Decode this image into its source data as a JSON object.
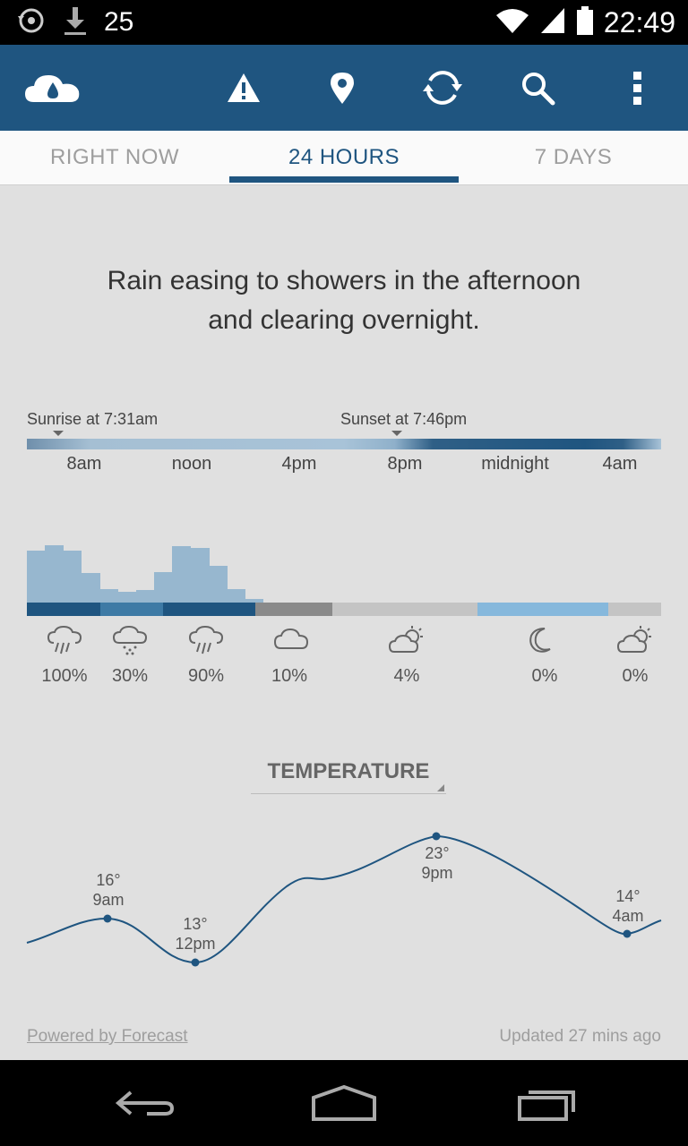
{
  "status_bar": {
    "notification_count": "25",
    "time": "22:49"
  },
  "app_bar": {
    "icons": [
      "cloud-rain-logo-icon",
      "alert-icon",
      "location-pin-icon",
      "refresh-icon",
      "search-icon",
      "overflow-menu-icon"
    ]
  },
  "tabs": [
    {
      "label": "RIGHT NOW",
      "active": false
    },
    {
      "label": "24 HOURS",
      "active": true
    },
    {
      "label": "7 DAYS",
      "active": false
    }
  ],
  "summary": {
    "line1": "Rain easing to showers in the afternoon",
    "line2": "and clearing overnight."
  },
  "daylight": {
    "sunrise": "Sunrise at 7:31am",
    "sunset": "Sunset at 7:46pm",
    "time_labels": [
      "8am",
      "noon",
      "4pm",
      "8pm",
      "midnight",
      "4am"
    ]
  },
  "precipitation": {
    "intensity": [
      0.8,
      0.88,
      0.79,
      0.45,
      0.2,
      0.16,
      0.19,
      0.47,
      0.87,
      0.84,
      0.56,
      0.21,
      0.06
    ],
    "conditions": [
      {
        "icon": "rain-icon",
        "probability": "100%"
      },
      {
        "icon": "showers-icon",
        "probability": "30%"
      },
      {
        "icon": "rain-icon",
        "probability": "90%"
      },
      {
        "icon": "cloud-icon",
        "probability": "10%"
      },
      {
        "icon": "partly-cloudy-day-icon",
        "probability": "4%"
      },
      {
        "icon": "moon-icon",
        "probability": "0%"
      },
      {
        "icon": "partly-cloudy-day-icon",
        "probability": "0%"
      }
    ],
    "colors": {
      "heavy": "#1f5580",
      "light": "#3e7aa5",
      "overcast": "#8a8a8a",
      "cloudy": "#c4c4c4",
      "clear_night": "#86b8dc"
    }
  },
  "temperature": {
    "title": "TEMPERATURE",
    "points": [
      {
        "temp": "16°",
        "time": "9am"
      },
      {
        "temp": "13°",
        "time": "12pm"
      },
      {
        "temp": "23°",
        "time": "9pm"
      },
      {
        "temp": "14°",
        "time": "4am"
      }
    ]
  },
  "footer": {
    "powered_by": "Powered by Forecast",
    "updated": "Updated 27 mins ago"
  }
}
